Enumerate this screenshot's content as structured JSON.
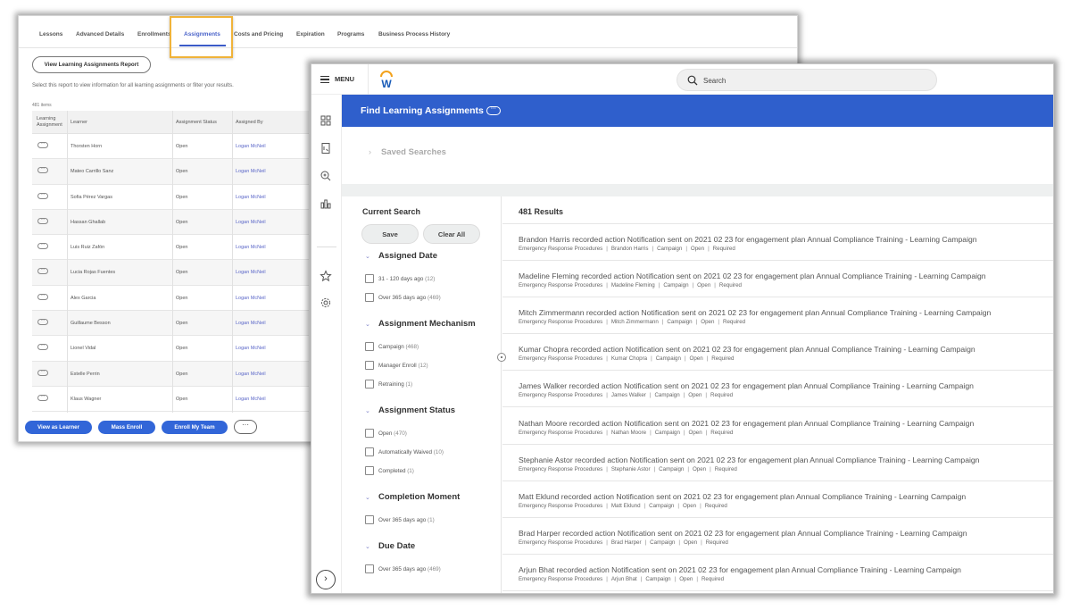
{
  "back_window": {
    "tabs": [
      {
        "label": "Lessons",
        "active": false
      },
      {
        "label": "Advanced Details",
        "active": false
      },
      {
        "label": "Enrollments",
        "active": false
      },
      {
        "label": "Assignments",
        "active": true
      },
      {
        "label": "Costs and Pricing",
        "active": false
      },
      {
        "label": "Expiration",
        "active": false
      },
      {
        "label": "Programs",
        "active": false
      },
      {
        "label": "Business Process History",
        "active": false
      }
    ],
    "report_button": "View Learning Assignments Report",
    "helper_text": "Select this report to view information for all learning assignments or filter your results.",
    "items_count": "481 items",
    "table": {
      "headers": [
        "Learning Assignment",
        "Learner",
        "Assignment Status",
        "Assigned By"
      ],
      "rows": [
        {
          "learner": "Thorsten Horn",
          "status": "Open",
          "assigned_by": "Logan McNeil"
        },
        {
          "learner": "Mateo Carrillo Sanz",
          "status": "Open",
          "assigned_by": "Logan McNeil"
        },
        {
          "learner": "Sofia Pérez Vargas",
          "status": "Open",
          "assigned_by": "Logan McNeil"
        },
        {
          "learner": "Hassan Ghallab",
          "status": "Open",
          "assigned_by": "Logan McNeil"
        },
        {
          "learner": "Luis Ruiz Zafón",
          "status": "Open",
          "assigned_by": "Logan McNeil"
        },
        {
          "learner": "Lucia Rojas Fuentes",
          "status": "Open",
          "assigned_by": "Logan McNeil"
        },
        {
          "learner": "Alex Garcia",
          "status": "Open",
          "assigned_by": "Logan McNeil"
        },
        {
          "learner": "Guillaume Besson",
          "status": "Open",
          "assigned_by": "Logan McNeil"
        },
        {
          "learner": "Lionel Vidal",
          "status": "Open",
          "assigned_by": "Logan McNeil"
        },
        {
          "learner": "Estelle Perrin",
          "status": "Open",
          "assigned_by": "Logan McNeil"
        },
        {
          "learner": "Klaus Wagner",
          "status": "Open",
          "assigned_by": "Logan McNeil"
        }
      ]
    },
    "footer_buttons": [
      "View as Learner",
      "Mass Enroll",
      "Enroll My Team"
    ],
    "more_button": "···",
    "highlight_color": "#f0b33a"
  },
  "front_window": {
    "menu_label": "MENU",
    "logo": "W",
    "search_placeholder": "Search",
    "nav_icons": [
      "apps-grid-icon",
      "report-icon",
      "zoom-search-icon",
      "bar-chart-icon",
      "star-icon",
      "gear-icon"
    ],
    "page_title": "Find Learning Assignments",
    "title_more": "···",
    "saved_searches": "Saved Searches",
    "current_search": {
      "title": "Current Search",
      "save_label": "Save",
      "clear_label": "Clear All"
    },
    "facets": [
      {
        "title": "Assigned Date",
        "options": [
          {
            "label": "31 - 120 days ago",
            "count": "(12)"
          },
          {
            "label": "Over 365 days ago",
            "count": "(469)"
          }
        ]
      },
      {
        "title": "Assignment Mechanism",
        "options": [
          {
            "label": "Campaign",
            "count": "(468)"
          },
          {
            "label": "Manager Enroll",
            "count": "(12)"
          },
          {
            "label": "Retraining",
            "count": "(1)"
          }
        ]
      },
      {
        "title": "Assignment Status",
        "options": [
          {
            "label": "Open",
            "count": "(470)"
          },
          {
            "label": "Automatically Waived",
            "count": "(10)"
          },
          {
            "label": "Completed",
            "count": "(1)"
          }
        ]
      },
      {
        "title": "Completion Moment",
        "options": [
          {
            "label": "Over 365 days ago",
            "count": "(1)"
          }
        ]
      },
      {
        "title": "Due Date",
        "options": [
          {
            "label": "Over 365 days ago",
            "count": "(469)"
          }
        ]
      }
    ],
    "results_count": "481 Results",
    "results": [
      {
        "title": "Brandon Harris recorded action Notification sent on 2021 02 23 for engagement plan Annual Compliance Training - Learning Campaign",
        "meta": [
          "Emergency Response Procedures",
          "Brandon Harris",
          "Campaign",
          "Open",
          "Required"
        ]
      },
      {
        "title": "Madeline Fleming recorded action Notification sent on 2021 02 23 for engagement plan Annual Compliance Training - Learning Campaign",
        "meta": [
          "Emergency Response Procedures",
          "Madeline Fleming",
          "Campaign",
          "Open",
          "Required"
        ]
      },
      {
        "title": "Mitch Zimmermann recorded action Notification sent on 2021 02 23 for engagement plan Annual Compliance Training - Learning Campaign",
        "meta": [
          "Emergency Response Procedures",
          "Mitch Zimmermann",
          "Campaign",
          "Open",
          "Required"
        ]
      },
      {
        "title": "Kumar Chopra recorded action Notification sent on 2021 02 23 for engagement plan Annual Compliance Training - Learning Campaign",
        "meta": [
          "Emergency Response Procedures",
          "Kumar Chopra",
          "Campaign",
          "Open",
          "Required"
        ]
      },
      {
        "title": "James Walker recorded action Notification sent on 2021 02 23 for engagement plan Annual Compliance Training - Learning Campaign",
        "meta": [
          "Emergency Response Procedures",
          "James Walker",
          "Campaign",
          "Open",
          "Required"
        ]
      },
      {
        "title": "Nathan Moore recorded action Notification sent on 2021 02 23 for engagement plan Annual Compliance Training - Learning Campaign",
        "meta": [
          "Emergency Response Procedures",
          "Nathan Moore",
          "Campaign",
          "Open",
          "Required"
        ]
      },
      {
        "title": "Stephanie Astor recorded action Notification sent on 2021 02 23 for engagement plan Annual Compliance Training - Learning Campaign",
        "meta": [
          "Emergency Response Procedures",
          "Stephanie Astor",
          "Campaign",
          "Open",
          "Required"
        ]
      },
      {
        "title": "Matt Eklund recorded action Notification sent on 2021 02 23 for engagement plan Annual Compliance Training - Learning Campaign",
        "meta": [
          "Emergency Response Procedures",
          "Matt Eklund",
          "Campaign",
          "Open",
          "Required"
        ]
      },
      {
        "title": "Brad Harper recorded action Notification sent on 2021 02 23 for engagement plan Annual Compliance Training - Learning Campaign",
        "meta": [
          "Emergency Response Procedures",
          "Brad Harper",
          "Campaign",
          "Open",
          "Required"
        ]
      },
      {
        "title": "Arjun Bhat recorded action Notification sent on 2021 02 23 for engagement plan Annual Compliance Training - Learning Campaign",
        "meta": [
          "Emergency Response Procedures",
          "Arjun Bhat",
          "Campaign",
          "Open",
          "Required"
        ]
      }
    ],
    "colors": {
      "header_blue": "#2f5fcc",
      "button_blue": "#3266d8",
      "link_purple": "#5a66c8"
    }
  }
}
